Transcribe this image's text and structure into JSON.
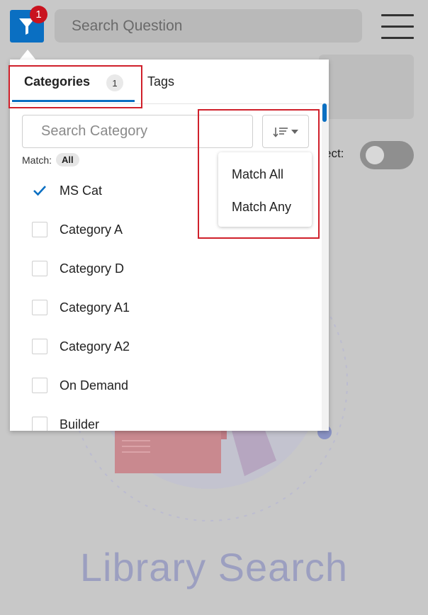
{
  "header": {
    "filter_badge_count": "1",
    "search_placeholder": "Search Question"
  },
  "background": {
    "select_label_partial": "ect:",
    "page_title": "Library Search"
  },
  "filter_popover": {
    "tabs": [
      {
        "label": "Categories",
        "count": "1",
        "active": true
      },
      {
        "label": "Tags",
        "active": false
      }
    ],
    "category_search_placeholder": "Search Category",
    "match_label": "Match:",
    "match_value": "All",
    "categories": [
      {
        "label": "MS Cat",
        "checked": true
      },
      {
        "label": "Category A",
        "checked": false
      },
      {
        "label": "Category D",
        "checked": false
      },
      {
        "label": "Category A1",
        "checked": false
      },
      {
        "label": "Category A2",
        "checked": false
      },
      {
        "label": "On Demand",
        "checked": false
      },
      {
        "label": "Builder",
        "checked": false
      }
    ]
  },
  "match_dropdown": {
    "options": [
      "Match All",
      "Match Any"
    ]
  },
  "colors": {
    "accent": "#0a6fc2",
    "badge": "#c9131f",
    "highlight": "#d0202b"
  }
}
